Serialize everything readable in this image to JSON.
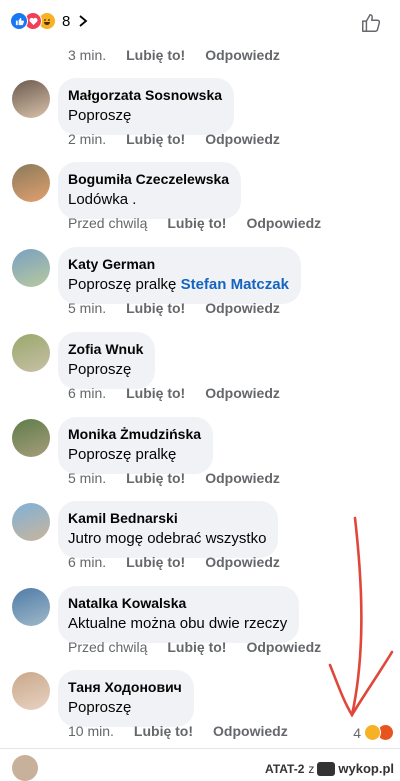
{
  "header": {
    "reaction_count": "8",
    "reaction_icons": [
      "like-icon",
      "love-icon",
      "haha-icon"
    ]
  },
  "first_meta": {
    "time": "3 min.",
    "like": "Lubię to!",
    "reply": "Odpowiedz"
  },
  "comments": [
    {
      "author": "Małgorzata Sosnowska",
      "text": "Poproszę",
      "time": "2 min.",
      "like": "Lubię to!",
      "reply": "Odpowiedz"
    },
    {
      "author": "Bogumiła Czeczelewska",
      "text": "Lodówka .",
      "time": "Przed chwilą",
      "like": "Lubię to!",
      "reply": "Odpowiedz"
    },
    {
      "author": "Katy German",
      "text": "Poproszę pralkę",
      "mention": "Stefan Matczak",
      "time": "5 min.",
      "like": "Lubię to!",
      "reply": "Odpowiedz"
    },
    {
      "author": "Zofia Wnuk",
      "text": "Poproszę",
      "time": "6 min.",
      "like": "Lubię to!",
      "reply": "Odpowiedz"
    },
    {
      "author": "Monika Żmudzińska",
      "text": "Poproszę pralkę",
      "time": "5 min.",
      "like": "Lubię to!",
      "reply": "Odpowiedz"
    },
    {
      "author": "Kamil Bednarski",
      "text": "Jutro mogę odebrać wszystko",
      "time": "6 min.",
      "like": "Lubię to!",
      "reply": "Odpowiedz"
    },
    {
      "author": "Natalka Kowalska",
      "text": "Aktualne można obu dwie rzeczy",
      "time": "Przed chwilą",
      "like": "Lubię to!",
      "reply": "Odpowiedz"
    },
    {
      "author": "Таня Ходонович",
      "text": "Poproszę",
      "time": "10 min.",
      "like": "Lubię to!",
      "reply": "Odpowiedz",
      "reaction_count": "4",
      "reaction_icons": [
        "haha-icon",
        "angry-icon"
      ]
    }
  ],
  "watermark": {
    "user": "ATAT-2",
    "z": "z",
    "site": "wykop.pl"
  },
  "colors": {
    "accent": "#1877f2",
    "mention": "#1565c0",
    "bubble": "#f0f2f5",
    "meta": "#65676b",
    "arrow": "#e0473a"
  }
}
